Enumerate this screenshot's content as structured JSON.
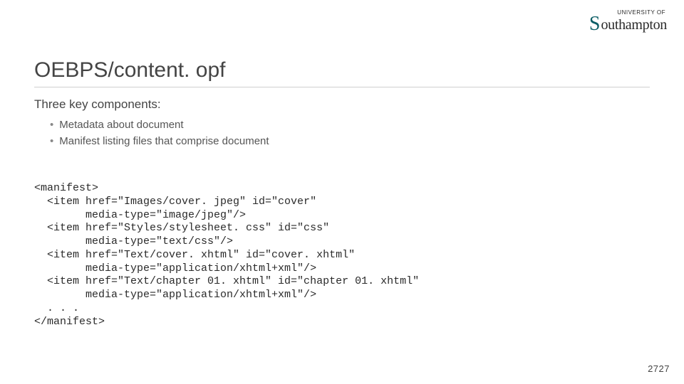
{
  "logo": {
    "topline": "UNIVERSITY OF",
    "initial": "S",
    "rest": "outhampton"
  },
  "title": "OEBPS/content. opf",
  "subhead": "Three key components:",
  "bullets": [
    "Metadata about document",
    "Manifest listing files that comprise document"
  ],
  "code": "<manifest>\n  <item href=\"Images/cover. jpeg\" id=\"cover\"\n        media-type=\"image/jpeg\"/>\n  <item href=\"Styles/stylesheet. css\" id=\"css\"\n        media-type=\"text/css\"/>\n  <item href=\"Text/cover. xhtml\" id=\"cover. xhtml\"\n        media-type=\"application/xhtml+xml\"/>\n  <item href=\"Text/chapter 01. xhtml\" id=\"chapter 01. xhtml\"\n        media-type=\"application/xhtml+xml\"/>\n  . . .\n</manifest>",
  "pagenum": "2727"
}
